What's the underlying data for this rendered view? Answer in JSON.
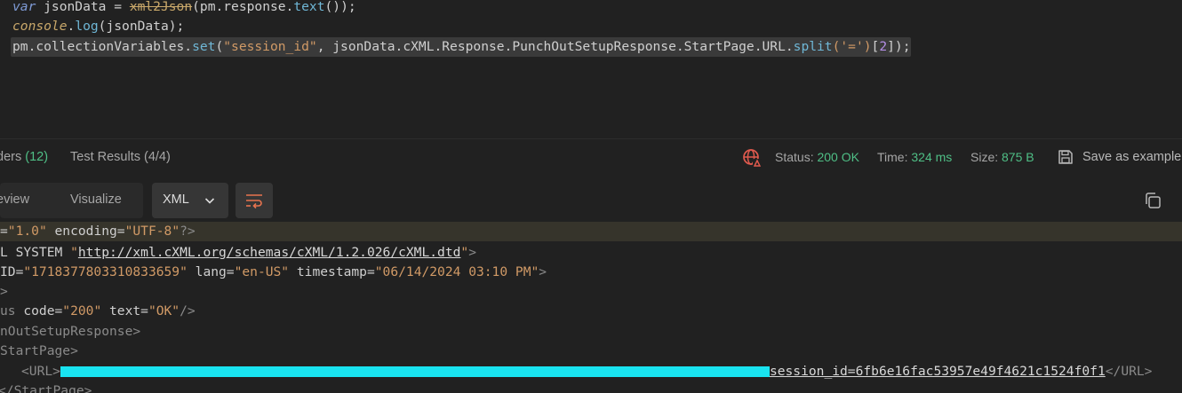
{
  "editor": {
    "line1": {
      "kw": "var",
      "name": " jsonData ",
      "eq": "=",
      "fn": "xml2Json",
      "args": "(pm.response.",
      "method": "text",
      "tail": "());"
    },
    "line2": {
      "obj": "console",
      "dot": ".",
      "method": "log",
      "tail": "(jsonData);"
    },
    "line3": {
      "head": "pm.collectionVariables.",
      "set": "set",
      "open": "(",
      "key": "\"session_id\"",
      "middle": ", jsonData.cXML.Response.PunchOutSetupResponse.StartPage.URL.",
      "split": "split",
      "splitArg": "('=')",
      "bo": "[",
      "idx": "2",
      "bc": "]",
      "end": ");"
    }
  },
  "response_tabs": {
    "headers_label": "ders",
    "headers_count": "(12)",
    "tests_label": "Test Results",
    "tests_count": "(4/4)"
  },
  "status": {
    "status_label": "Status:",
    "status_value": "200 OK",
    "time_label": "Time:",
    "time_value": "324 ms",
    "size_label": "Size:",
    "size_value": "875 B",
    "save_label": "Save as example"
  },
  "view": {
    "preview_label": "eview",
    "visualize_label": "Visualize",
    "format": "XML"
  },
  "xml": {
    "l1": {
      "pre": "=",
      "v1": "\"1.0\"",
      "a2": " encoding=",
      "v2": "\"UTF-8\"",
      "end": "?>"
    },
    "l2": {
      "pre": "L SYSTEM ",
      "q1": "\"",
      "url": "http://xml.cXML.org/schemas/cXML/1.2.026/cXML.dtd",
      "q2": "\"",
      "end": ">"
    },
    "l3": {
      "pre": "ID=",
      "v1": "\"1718377803310833659\"",
      "a2": " lang=",
      "v2": "\"en-US\"",
      "a3": " timestamp=",
      "v3": "\"06/14/2024 03:10 PM\"",
      "end": ">"
    },
    "l4": {
      "text": ">"
    },
    "l5": {
      "tag": "us",
      "a1": " code=",
      "v1": "\"200\"",
      "a2": " text=",
      "v2": "\"OK\"",
      "end": "/>"
    },
    "l6": {
      "tag": "nOutSetupResponse",
      "end": ">"
    },
    "l7": {
      "tag": "StartPage",
      "end": ">"
    },
    "l8": {
      "open": "<URL>",
      "tail": "session_id=6fb6e16fac53957e49f4621c1524f0f1",
      "close": "</URL>"
    },
    "l9": {
      "text": "</StartPage>"
    }
  }
}
